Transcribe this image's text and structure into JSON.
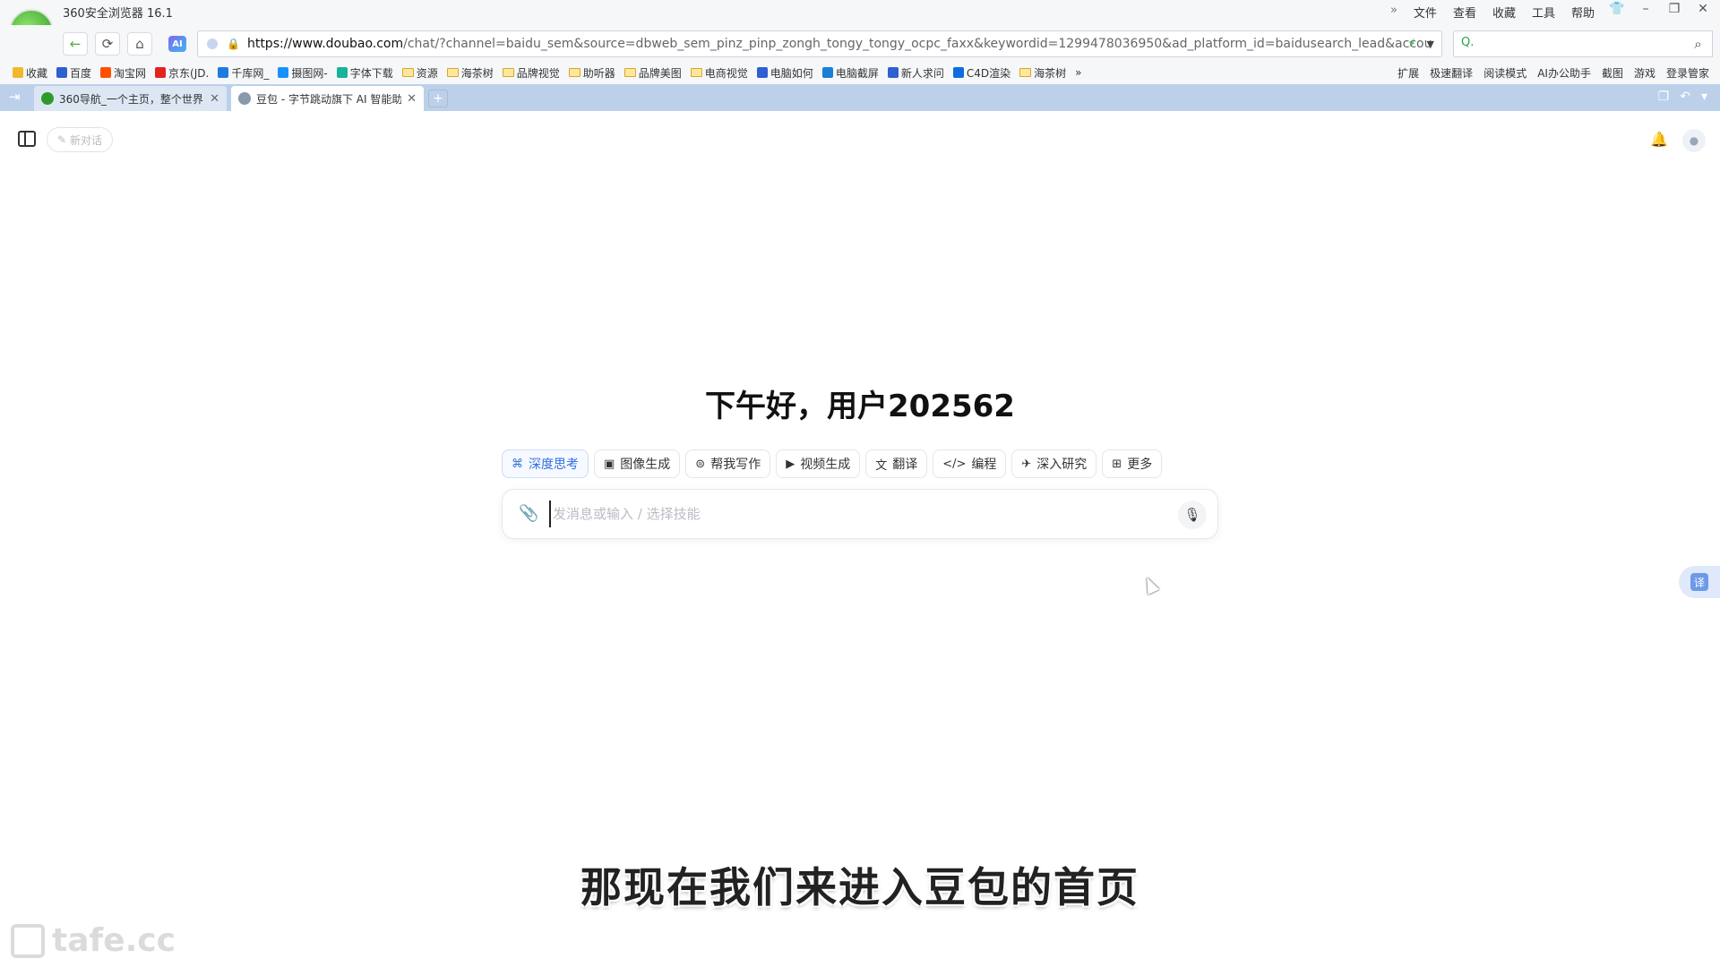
{
  "browser": {
    "title": "360安全浏览器 16.1",
    "menu": [
      "文件",
      "查看",
      "收藏",
      "工具",
      "帮助"
    ],
    "url_host": "https://www.doubao.com",
    "url_rest": "/chat/?channel=baidu_sem&source=dbweb_sem_pinz_pinp_zongh_tongy_tongy_ocpc_faxx&keywordid=1299478036950&ad_platform_id=baidusearch_lead&accou",
    "search_placeholder": "Q.",
    "bookmarks": [
      {
        "label": "收藏",
        "icon": "star-icon"
      },
      {
        "label": "百度",
        "icon": "baidu-icon"
      },
      {
        "label": "淘宝网",
        "icon": "taobao-icon"
      },
      {
        "label": "京东(JD.",
        "icon": "jd-icon"
      },
      {
        "label": "千库网_",
        "icon": "qianku-icon"
      },
      {
        "label": "摄图网-",
        "icon": "shetu-icon"
      },
      {
        "label": "字体下载",
        "icon": "font-icon"
      },
      {
        "label": "资源",
        "icon": "folder-icon"
      },
      {
        "label": "海茶树",
        "icon": "folder-icon"
      },
      {
        "label": "品牌视觉",
        "icon": "folder-icon"
      },
      {
        "label": "助听器",
        "icon": "folder-icon"
      },
      {
        "label": "品牌美图",
        "icon": "folder-icon"
      },
      {
        "label": "电商视觉",
        "icon": "folder-icon"
      },
      {
        "label": "电脑如何",
        "icon": "baidu-icon"
      },
      {
        "label": "电脑截屏",
        "icon": "edge-icon"
      },
      {
        "label": "新人求问",
        "icon": "baidu-icon"
      },
      {
        "label": "C4D渲染",
        "icon": "zhihu-icon"
      },
      {
        "label": "海茶树",
        "icon": "folder-icon"
      }
    ],
    "bookmarks_more": "»",
    "toolbar_right": [
      "扩展",
      "极速翻译",
      "阅读模式",
      "AI办公助手",
      "截图",
      "游戏",
      "登录管家"
    ],
    "tabs": [
      {
        "label": "360导航_一个主页，整个世界",
        "active": false,
        "favicon_color": "#2d9b2a"
      },
      {
        "label": "豆包 - 字节跳动旗下 AI 智能助手",
        "active": true,
        "favicon_color": "#8899aa"
      }
    ],
    "new_tab": "+"
  },
  "page": {
    "new_chat_label": "新对话",
    "greeting": "下午好，用户202562",
    "skills": [
      {
        "label": "深度思考",
        "icon": "deep-think-icon",
        "glyph": "⌘",
        "active": true
      },
      {
        "label": "图像生成",
        "icon": "image-icon",
        "glyph": "▣",
        "active": false
      },
      {
        "label": "帮我写作",
        "icon": "write-icon",
        "glyph": "⊜",
        "active": false
      },
      {
        "label": "视频生成",
        "icon": "video-icon",
        "glyph": "▶",
        "active": false
      },
      {
        "label": "翻译",
        "icon": "translate-icon",
        "glyph": "文",
        "active": false
      },
      {
        "label": "编程",
        "icon": "code-icon",
        "glyph": "</>",
        "active": false
      },
      {
        "label": "深入研究",
        "icon": "research-icon",
        "glyph": "✈",
        "active": false
      },
      {
        "label": "更多",
        "icon": "grid-icon",
        "glyph": "⊞",
        "active": false
      }
    ],
    "input_placeholder": "发消息或输入 / 选择技能",
    "translate_fab": "译"
  },
  "overlay": {
    "subtitle": "那现在我们来进入豆包的首页",
    "watermark": "tafe.cc"
  },
  "colors": {
    "accent": "#2f6fe0",
    "tabbar": "#bcd0ea",
    "browser_green": "#2d9b2a"
  }
}
